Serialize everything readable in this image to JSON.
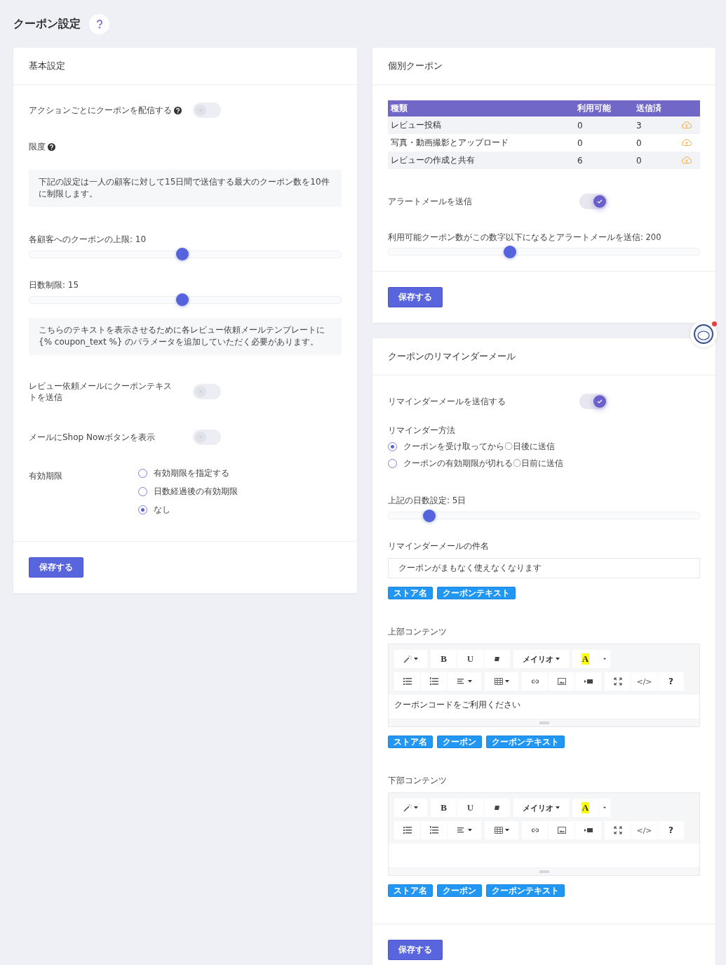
{
  "page": {
    "title": "クーポン設定"
  },
  "basic": {
    "title": "基本設定",
    "rows": [
      {
        "kind": "toggle",
        "label": "アクションごとにクーポンを配信する",
        "help": true,
        "on": false
      },
      {
        "kind": "heading",
        "label": "限度",
        "help": true
      },
      {
        "kind": "note",
        "text": "下記の設定は一人の顧客に対して15日間で送信する最大のクーポン数を10件に制限します。"
      },
      {
        "kind": "slider",
        "label": "各顧客へのクーポンの上限: 10",
        "level": 0.49
      },
      {
        "kind": "slider",
        "label": "日数制限: 15",
        "level": 0.49
      },
      {
        "kind": "note",
        "text": "こちらのテキストを表示させるために各レビュー依頼メールテンプレートに {% coupon_text %} のパラメータを追加していただく必要があります。"
      },
      {
        "kind": "toggle",
        "label": "レビュー依頼メールにクーポンテキストを送信",
        "help": false,
        "on": false
      },
      {
        "kind": "toggle",
        "label": "メールにShop Nowボタンを表示",
        "help": false,
        "on": false
      },
      {
        "kind": "radios",
        "label": "有効期限",
        "options": [
          {
            "label": "有効期限を指定する",
            "selected": false
          },
          {
            "label": "日数経過後の有効期限",
            "selected": false
          },
          {
            "label": "なし",
            "selected": true
          }
        ]
      }
    ],
    "save_button": "保存する"
  },
  "individual": {
    "title": "個別クーポン",
    "table": {
      "columns": [
        "種類",
        "利用可能",
        "送信済"
      ],
      "rows": [
        [
          "レビュー投稿",
          "0",
          "3"
        ],
        [
          "写真・動画撮影とアップロード",
          "0",
          "0"
        ],
        [
          "レビューの作成と共有",
          "6",
          "0"
        ]
      ]
    },
    "alert_toggle": {
      "label": "アラートメールを送信",
      "on": true
    },
    "alert_slider": {
      "label": "利用可能クーポン数がこの数字以下になるとアラートメールを送信: 200",
      "level": 0.39
    },
    "save_button": "保存する"
  },
  "reminder": {
    "title": "クーポンのリマインダーメール",
    "send_toggle": {
      "label": "リマインダーメールを送信する",
      "on": true
    },
    "method": {
      "label": "リマインダー方法",
      "options": [
        {
          "label": "クーポンを受け取ってから〇日後に送信",
          "selected": true
        },
        {
          "label": "クーポンの有効期限が切れる〇日前に送信",
          "selected": false
        }
      ]
    },
    "days_slider": {
      "label": "上記の日数設定: 5日",
      "level": 0.13
    },
    "subject": {
      "label": "リマインダーメールの件名",
      "value": "クーポンがまもなく使えなくなります",
      "tags": [
        "ストア名",
        "クーポンテキスト"
      ]
    },
    "editors": [
      {
        "label": "上部コンテンツ",
        "toolbar": [
          [
            [
              {
                "kind": "magic"
              }
            ],
            [
              {
                "kind": "bold",
                "label": "B"
              },
              {
                "kind": "underline",
                "label": "U"
              },
              {
                "kind": "eraser"
              }
            ],
            [
              {
                "kind": "font",
                "label": "メイリオ"
              }
            ],
            [
              {
                "kind": "color",
                "label": "A"
              },
              {
                "kind": "menu"
              }
            ]
          ],
          [
            [
              {
                "kind": "ul"
              },
              {
                "kind": "ol"
              },
              {
                "kind": "align"
              }
            ],
            [
              {
                "kind": "table"
              }
            ],
            [
              {
                "kind": "link"
              },
              {
                "kind": "image"
              },
              {
                "kind": "video"
              }
            ],
            [
              {
                "kind": "fullscreen"
              },
              {
                "kind": "code",
                "label": "</>"
              },
              {
                "kind": "help",
                "label": "?"
              }
            ]
          ]
        ],
        "content": "クーポンコードをご利用ください",
        "tags": [
          "ストア名",
          "クーポン",
          "クーポンテキスト"
        ]
      },
      {
        "label": "下部コンテンツ",
        "toolbar": [
          [
            [
              {
                "kind": "magic"
              }
            ],
            [
              {
                "kind": "bold",
                "label": "B"
              },
              {
                "kind": "underline",
                "label": "U"
              },
              {
                "kind": "eraser"
              }
            ],
            [
              {
                "kind": "font",
                "label": "メイリオ"
              }
            ],
            [
              {
                "kind": "color",
                "label": "A"
              },
              {
                "kind": "menu"
              }
            ]
          ],
          [
            [
              {
                "kind": "ul"
              },
              {
                "kind": "ol"
              },
              {
                "kind": "align"
              }
            ],
            [
              {
                "kind": "table"
              }
            ],
            [
              {
                "kind": "link"
              },
              {
                "kind": "image"
              },
              {
                "kind": "video"
              }
            ],
            [
              {
                "kind": "fullscreen"
              },
              {
                "kind": "code",
                "label": "</>"
              },
              {
                "kind": "help",
                "label": "?"
              }
            ]
          ]
        ],
        "tags": [
          "ストア名",
          "クーポン",
          "クーポンテキスト"
        ]
      }
    ],
    "save_button": "保存する"
  }
}
